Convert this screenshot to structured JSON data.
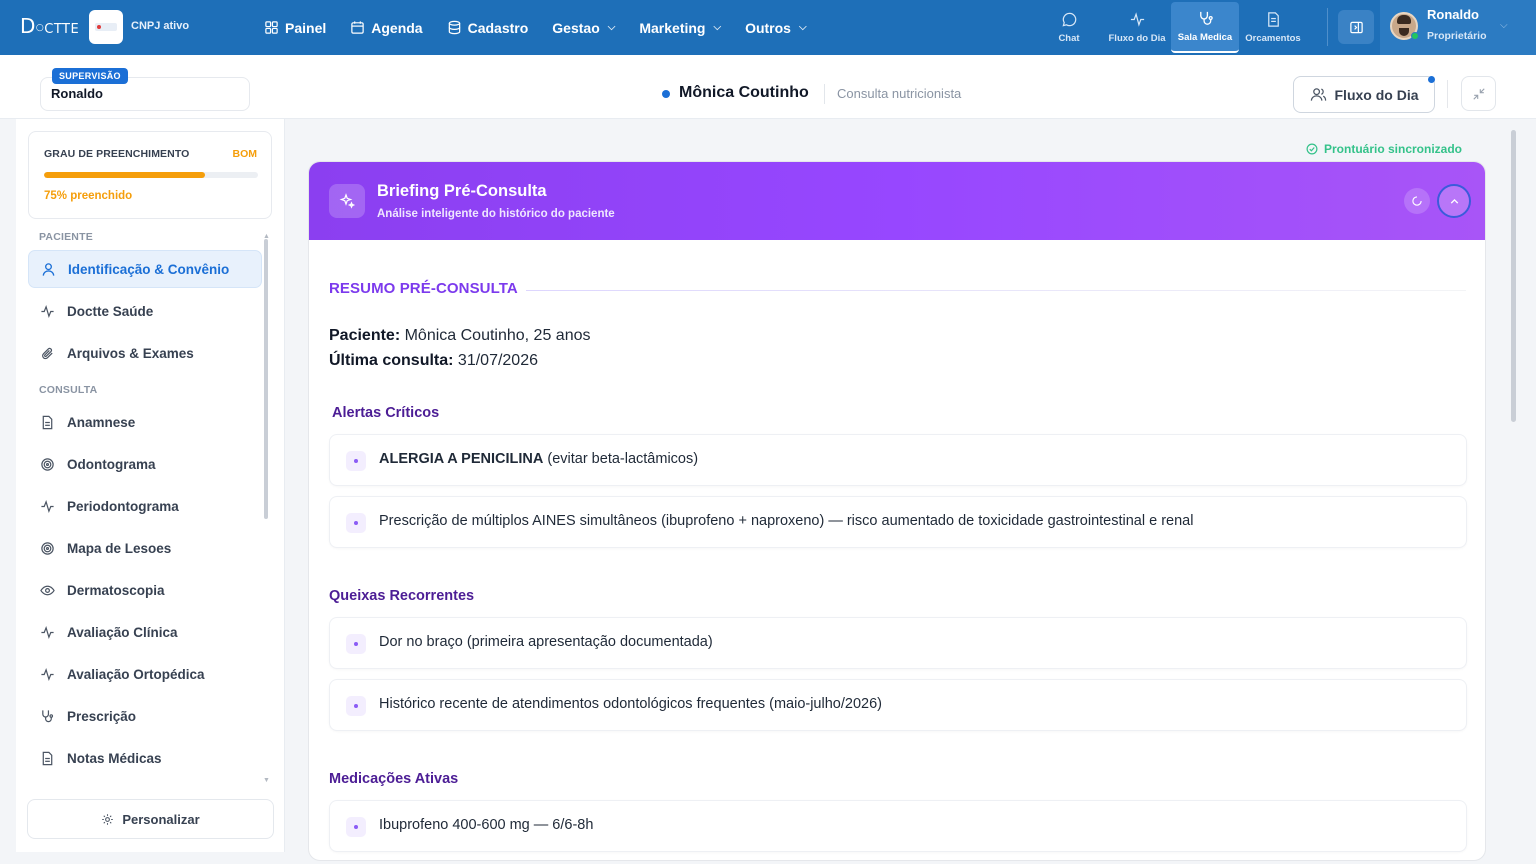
{
  "topbar": {
    "logo_main": "D",
    "logo_rest": "CTTE",
    "clinic_status": "CNPJ ativo",
    "nav": [
      {
        "label": "Painel",
        "icon": "grid-icon"
      },
      {
        "label": "Agenda",
        "icon": "calendar-icon"
      },
      {
        "label": "Cadastro",
        "icon": "database-icon"
      },
      {
        "label": "Gestao",
        "icon": "chevron-down-icon"
      },
      {
        "label": "Marketing",
        "icon": "chevron-down-icon"
      },
      {
        "label": "Outros",
        "icon": "chevron-down-icon"
      }
    ],
    "quick": [
      {
        "label": "Chat",
        "icon": "chat-icon"
      },
      {
        "label": "Fluxo do Dia",
        "icon": "activity-icon"
      },
      {
        "label": "Sala Medica",
        "icon": "stethoscope-icon",
        "active": true
      },
      {
        "label": "Orcamentos",
        "icon": "document-icon"
      }
    ],
    "user": {
      "name": "Ronaldo",
      "role": "Proprietário"
    }
  },
  "subheader": {
    "supervision_tag": "SUPERVISÃO",
    "supervisor": "Ronaldo",
    "patient_name": "Mônica Coutinho",
    "consult_type": "Consulta nutricionista",
    "flow_button": "Fluxo do Dia"
  },
  "sidebar": {
    "progress": {
      "title": "GRAU DE PREENCHIMENTO",
      "status": "BOM",
      "percent": 75,
      "text": "75% preenchido",
      "color": "#f59e0b"
    },
    "section_paciente": "PACIENTE",
    "section_consulta": "CONSULTA",
    "items": [
      {
        "label": "Identificação & Convênio",
        "icon": "user-icon",
        "active": true
      },
      {
        "label": "Doctte Saúde",
        "icon": "activity-icon"
      },
      {
        "label": "Arquivos & Exames",
        "icon": "paperclip-icon"
      },
      {
        "label": "Anamnese",
        "icon": "document-icon"
      },
      {
        "label": "Odontograma",
        "icon": "target-icon"
      },
      {
        "label": "Periodontograma",
        "icon": "activity-icon"
      },
      {
        "label": "Mapa de Lesoes",
        "icon": "target-icon"
      },
      {
        "label": "Dermatoscopia",
        "icon": "eye-icon"
      },
      {
        "label": "Avaliação Clínica",
        "icon": "activity-icon"
      },
      {
        "label": "Avaliação Ortopédica",
        "icon": "activity-icon"
      },
      {
        "label": "Prescrição",
        "icon": "stethoscope-icon"
      },
      {
        "label": "Notas Médicas",
        "icon": "document-icon"
      }
    ],
    "customize": "Personalizar"
  },
  "main": {
    "sync_status": "Prontuário sincronizado",
    "briefing": {
      "title": "Briefing Pré-Consulta",
      "subtitle": "Análise inteligente do histórico do paciente",
      "section_title": "RESUMO PRÉ-CONSULTA",
      "patient_label": "Paciente:",
      "patient_value": "Mônica Coutinho, 25 anos",
      "last_label": "Última consulta:",
      "last_value": "31/07/2026",
      "alerts_title": "Alertas Críticos",
      "alerts": [
        {
          "bold": "ALERGIA A PENICILINA",
          "text": " (evitar beta-lactâmicos)"
        },
        {
          "bold": "",
          "text": "Prescrição de múltiplos AINES simultâneos (ibuprofeno + naproxeno) — risco aumentado de toxicidade gastrointestinal e renal"
        }
      ],
      "complaints_title": "Queixas Recorrentes",
      "complaints": [
        {
          "text": "Dor no braço (primeira apresentação documentada)"
        },
        {
          "text": "Histórico recente de atendimentos odontológicos frequentes (maio-julho/2026)"
        }
      ],
      "meds_title": "Medicações Ativas",
      "meds": [
        {
          "text": "Ibuprofeno 400-600 mg — 6/6-8h"
        }
      ]
    }
  }
}
